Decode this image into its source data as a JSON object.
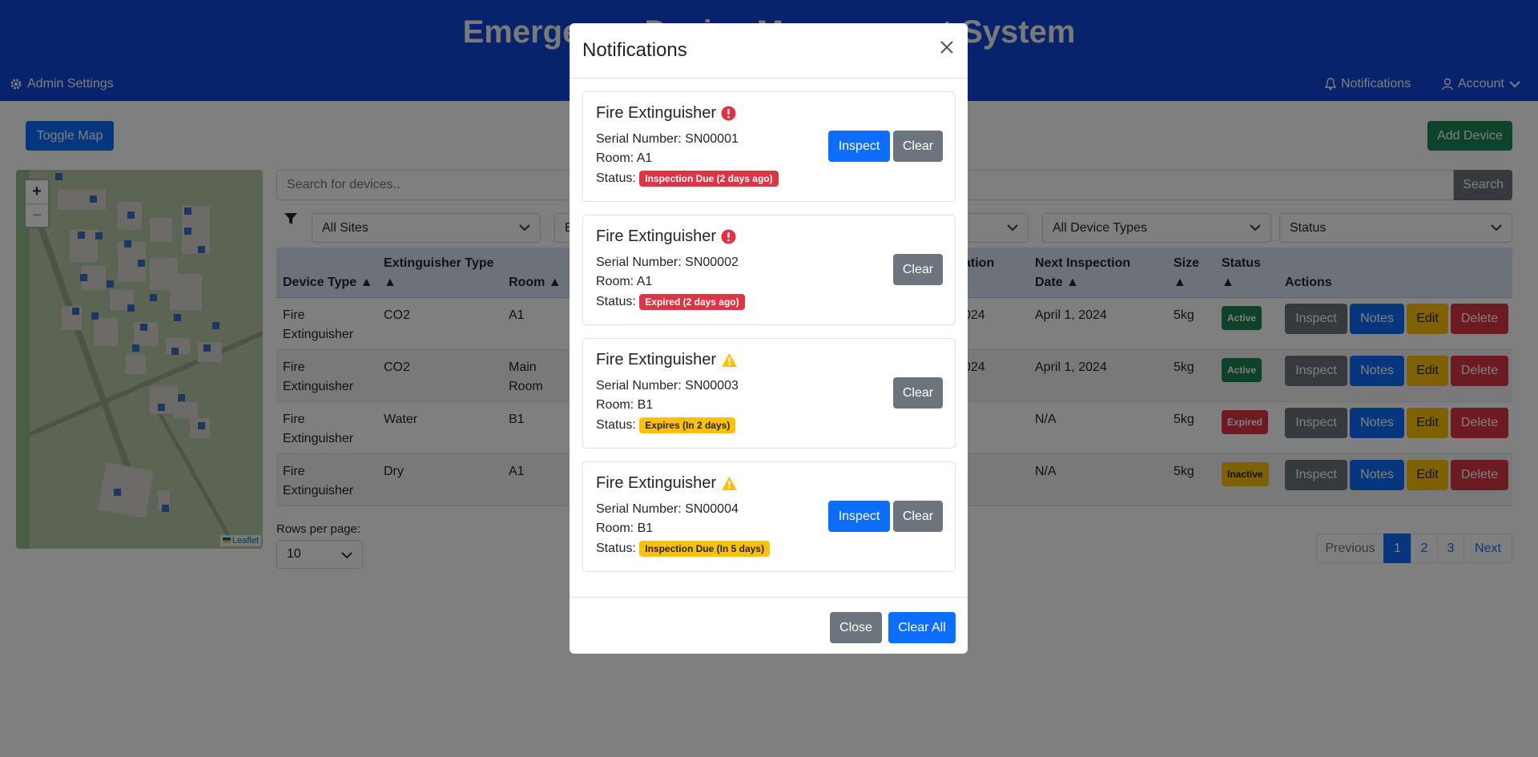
{
  "app": {
    "title": "Emergency Device Management System"
  },
  "nav": {
    "admin_settings": "Admin Settings",
    "notifications": "Notifications",
    "account": "Account"
  },
  "toolbar": {
    "toggle_map": "Toggle Map",
    "add_device": "Add Device"
  },
  "map": {
    "attribution": "Leaflet",
    "zoom_in": "+",
    "zoom_out": "−"
  },
  "search": {
    "placeholder": "Search for devices..",
    "button": "Search"
  },
  "filters": {
    "sites": "All Sites",
    "buildings": "B",
    "floors": "",
    "device_types": "All Device Types",
    "status": "Status"
  },
  "table": {
    "headers": {
      "device_type": "Device Type ▲",
      "extinguisher_type_1": "Extinguisher Type",
      "extinguisher_type_2": "▲",
      "room": "Room ▲",
      "last_inspection": "ation",
      "next_inspection_1": "Next Inspection",
      "next_inspection_2": "Date ▲",
      "size_1": "Size",
      "size_2": "▲",
      "status_1": "Status",
      "status_2": "▲",
      "actions": "Actions"
    },
    "rows": [
      {
        "device_type_1": "Fire",
        "device_type_2": "Extinguisher",
        "ext_type": "CO2",
        "room_1": "A1",
        "room_2": "",
        "last": "024",
        "next": "April 1, 2024",
        "size": "5kg",
        "status": "Active"
      },
      {
        "device_type_1": "Fire",
        "device_type_2": "Extinguisher",
        "ext_type": "CO2",
        "room_1": "Main",
        "room_2": "Room",
        "last": "024",
        "next": "April 1, 2024",
        "size": "5kg",
        "status": "Active"
      },
      {
        "device_type_1": "Fire",
        "device_type_2": "Extinguisher",
        "ext_type": "Water",
        "room_1": "B1",
        "room_2": "",
        "last": "",
        "next": "N/A",
        "size": "5kg",
        "status": "Expired"
      },
      {
        "device_type_1": "Fire",
        "device_type_2": "Extinguisher",
        "ext_type": "Dry",
        "room_1": "A1",
        "room_2": "",
        "last": "",
        "next": "N/A",
        "size": "5kg",
        "status": "Inactive"
      }
    ],
    "actions": {
      "inspect": "Inspect",
      "notes": "Notes",
      "edit": "Edit",
      "delete": "Delete"
    }
  },
  "pagination": {
    "rows_label": "Rows per page:",
    "rows_value": "10",
    "previous": "Previous",
    "pages": [
      "1",
      "2",
      "3"
    ],
    "next": "Next"
  },
  "modal": {
    "title": "Notifications",
    "cards": [
      {
        "title": "Fire Extinguisher",
        "serial": "Serial Number: SN00001",
        "room": "Room: A1",
        "status_label": "Status:",
        "status_badge": "Inspection Due (2 days ago)",
        "severity": "error",
        "inspect": "Inspect",
        "clear": "Clear"
      },
      {
        "title": "Fire Extinguisher",
        "serial": "Serial Number: SN00002",
        "room": "Room: A1",
        "status_label": "Status:",
        "status_badge": "Expired (2 days ago)",
        "severity": "error",
        "clear": "Clear"
      },
      {
        "title": "Fire Extinguisher",
        "serial": "Serial Number: SN00003",
        "room": "Room: B1",
        "status_label": "Status:",
        "status_badge": "Expires (In 2 days)",
        "severity": "warning",
        "clear": "Clear"
      },
      {
        "title": "Fire Extinguisher",
        "serial": "Serial Number: SN00004",
        "room": "Room: B1",
        "status_label": "Status:",
        "status_badge": "Inspection Due (In 5 days)",
        "severity": "warning",
        "inspect": "Inspect",
        "clear": "Clear"
      }
    ],
    "close": "Close",
    "clear_all": "Clear All"
  },
  "colors": {
    "header": "#0d47d6",
    "primary": "#0d6efd",
    "secondary": "#6c757d",
    "success": "#198754",
    "danger": "#dc3545",
    "warning": "#ffc107"
  }
}
